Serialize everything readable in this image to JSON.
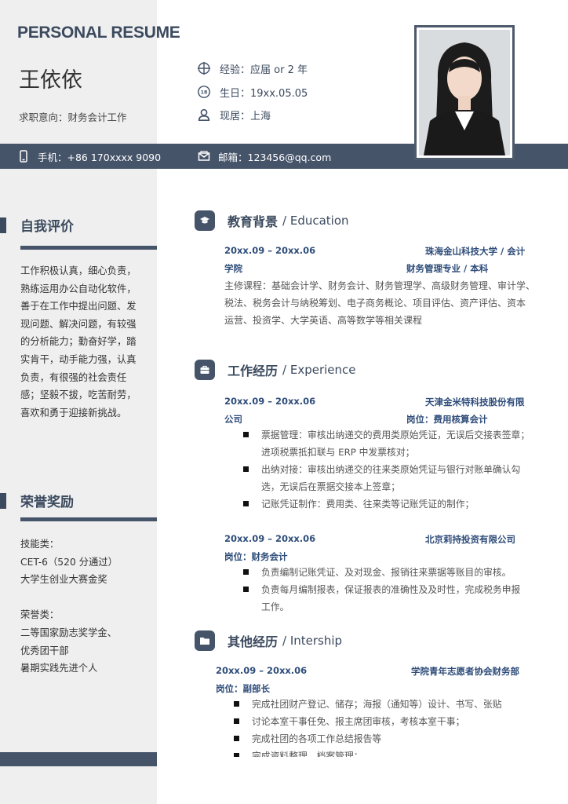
{
  "header": {
    "resume_title": "PERSONAL RESUME",
    "name": "王依依",
    "job_intent": "求职意向：财务会计工作"
  },
  "info": {
    "experience": "经验：应届  or 2 年",
    "birthday": "生日：19xx.05.05",
    "location": "现居：上海",
    "phone": "手机：+86 170xxxx 9090",
    "email": "邮箱：123456@qq.com"
  },
  "sidebar": {
    "self_eval": {
      "title": "自我评价",
      "lines": [
        "工作积极认真，细心负责，",
        "熟练运用办公自动化软件，",
        "善于在工作中提出问题、发",
        "现问题、解决问题，有较强",
        "的分析能力；勤奋好学，踏",
        "实肯干，动手能力强，认真",
        "负责，有很强的社会责任",
        "感；坚毅不拔，吃苦耐劳，",
        "喜欢和勇于迎接新挑战。"
      ]
    },
    "awards": {
      "title": "荣誉奖励",
      "lines": [
        "技能类：",
        "CET-6（520 分通过）",
        "大学生创业大赛金奖",
        "",
        "荣誉类：",
        "二等国家励志奖学金、",
        "优秀团干部",
        "暑期实践先进个人"
      ]
    }
  },
  "education": {
    "title": "教育背景",
    "en": "/ Education",
    "date": "20xx.09 – 20xx.06",
    "school_a": "珠海金山科技大学  /  会计",
    "school_b": "学院",
    "major": "财务管理专业  /  本科",
    "courses": [
      "主修课程：基础会计学、财务会计、财务管理学、高级财务管理、审计学、",
      "税法、税务会计与纳税筹划、电子商务概论、项目评估、资产评估、资本",
      "运营、投资学、大学英语、高等数学等相关课程"
    ]
  },
  "work": {
    "title": "工作经历",
    "en": "/ Experience",
    "job1": {
      "date": "20xx.09 – 20xx.06",
      "company_a": "天津金米特科技股份有限",
      "company_b": "公司",
      "position": "岗位：费用核算会计",
      "bullets": [
        [
          "票据管理：审核出纳递交的费用类原始凭证，无误后交接表签章；",
          "进项税票抵扣联与 ERP 中发票核对；"
        ],
        [
          "出纳对接：审核出纳递交的往来类原始凭证与银行对账单确认勾",
          "选，无误后在票据交接本上签章；"
        ],
        [
          "记账凭证制作：费用类、往来类等记账凭证的制作；"
        ]
      ]
    },
    "job2": {
      "date": "20xx.09 – 20xx.06",
      "company": "北京莉持投资有限公司",
      "position": "岗位：财务会计",
      "bullets": [
        [
          "负责编制记账凭证、及对现金、报销往来票据等账目的审核。"
        ],
        [
          "负责每月编制报表，保证报表的准确性及及时性，完成税务申报",
          "工作。"
        ]
      ]
    }
  },
  "other": {
    "title": "其他经历",
    "en": "/ Intership",
    "date": "20xx.09 – 20xx.06",
    "org": "学院青年志愿者协会财务部",
    "position": "岗位：副部长",
    "bullets": [
      [
        "完成社团财产登记、储存；海报（通知等）设计、书写、张贴"
      ],
      [
        "讨论本室干事任免、报主席团审核，考核本室干事；"
      ],
      [
        "完成社团的各项工作总结报告等"
      ],
      [
        "完成资料整理，档案管理；"
      ]
    ]
  },
  "colors": {
    "accent": "#46546a",
    "heading": "#3b4a5e",
    "entry": "#2f4d7a",
    "sidebar": "#efefef"
  }
}
